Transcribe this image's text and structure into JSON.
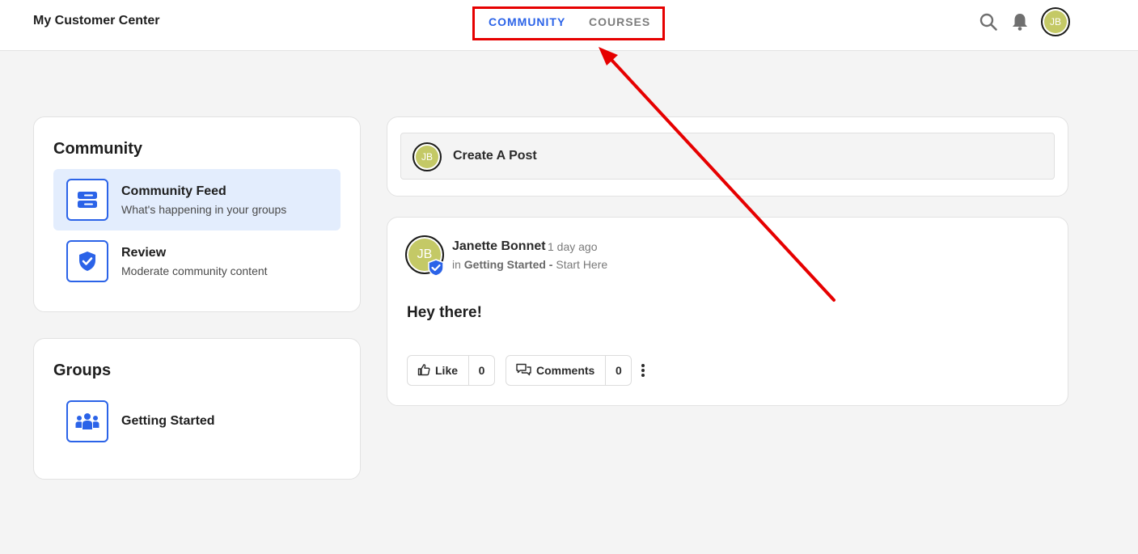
{
  "header": {
    "brand": "My Customer Center",
    "tabs": [
      {
        "label": "COMMUNITY",
        "active": true
      },
      {
        "label": "COURSES",
        "active": false
      }
    ],
    "user_initials": "JB"
  },
  "colors": {
    "accent": "#2b63e8",
    "annotation": "#e60000",
    "avatar": "#c4c966",
    "active_item_bg": "#e3edfd"
  },
  "sidebar": {
    "community": {
      "title": "Community",
      "items": [
        {
          "title": "Community Feed",
          "subtitle": "What's happening in your groups",
          "icon": "feed-icon",
          "active": true
        },
        {
          "title": "Review",
          "subtitle": "Moderate community content",
          "icon": "shield-check-icon",
          "active": false
        }
      ]
    },
    "groups": {
      "title": "Groups",
      "items": [
        {
          "title": "Getting Started",
          "icon": "group-icon"
        }
      ]
    }
  },
  "create_post": {
    "label": "Create A Post",
    "avatar": "JB"
  },
  "post": {
    "avatar": "JB",
    "author": "Janette Bonnet",
    "time": "1 day ago",
    "in_prefix": "in",
    "group": "Getting Started -",
    "group_suffix": "Start Here",
    "body": "Hey there!",
    "like_label": "Like",
    "like_count": "0",
    "comments_label": "Comments",
    "comments_count": "0"
  }
}
